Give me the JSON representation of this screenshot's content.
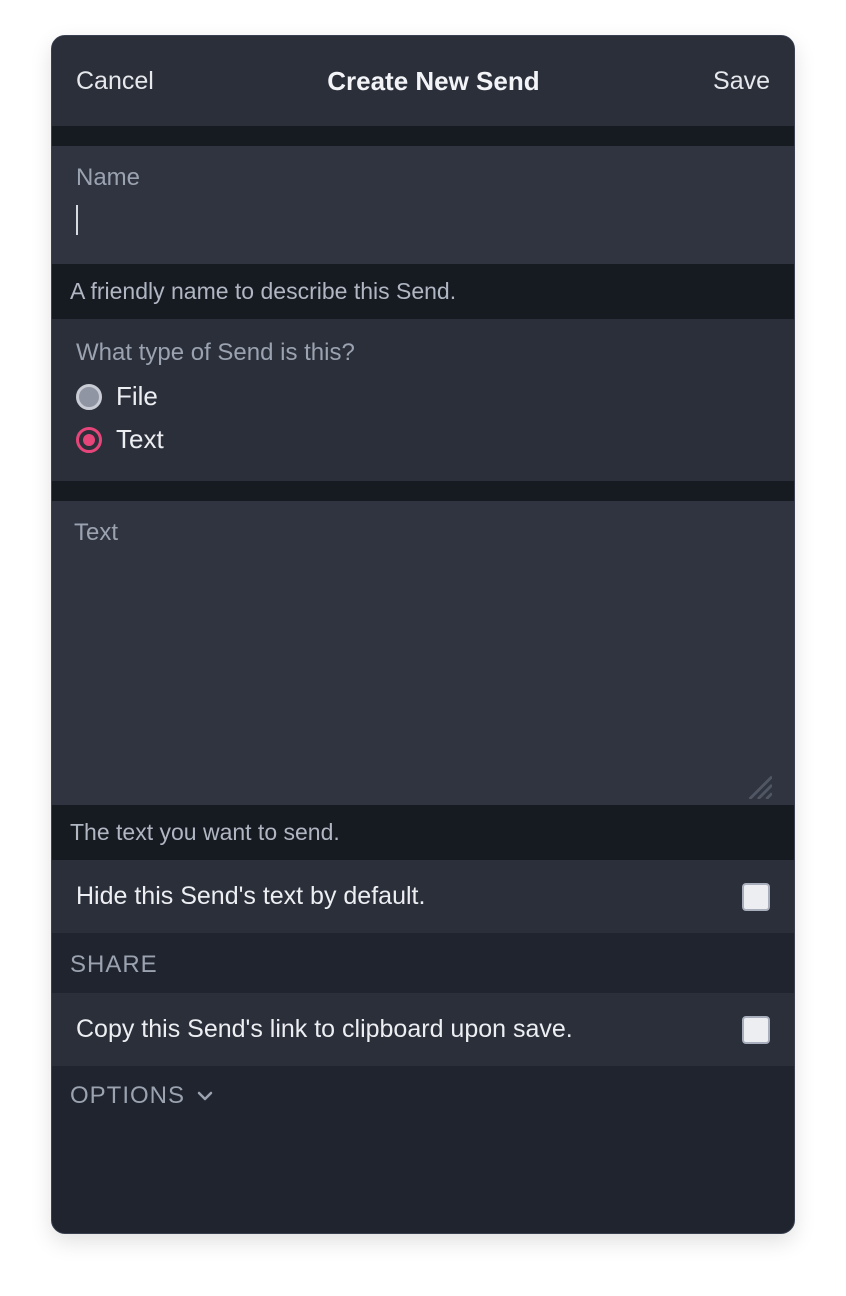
{
  "titlebar": {
    "cancel": "Cancel",
    "title": "Create New Send",
    "save": "Save"
  },
  "name": {
    "label": "Name",
    "value": "",
    "help": "A friendly name to describe this Send."
  },
  "type": {
    "question": "What type of Send is this?",
    "options": [
      {
        "label": "File",
        "selected": false
      },
      {
        "label": "Text",
        "selected": true
      }
    ]
  },
  "text": {
    "label": "Text",
    "value": "",
    "help": "The text you want to send.",
    "hide_label": "Hide this Send's text by default.",
    "hide_checked": false
  },
  "share": {
    "header": "SHARE",
    "copy_label": "Copy this Send's link to clipboard upon save.",
    "copy_checked": false
  },
  "options": {
    "label": "OPTIONS",
    "expanded": false
  },
  "colors": {
    "accent": "#e6457a"
  }
}
